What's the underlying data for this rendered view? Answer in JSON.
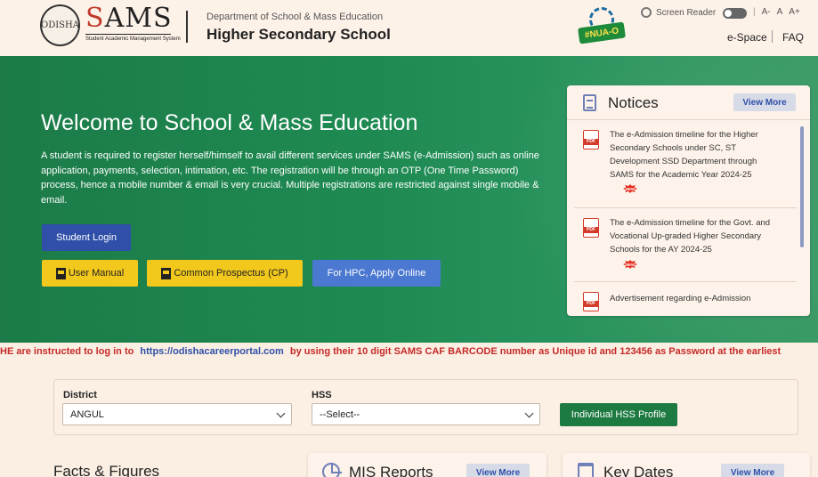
{
  "header": {
    "emblem_text": "ODISHA",
    "logo_s": "S",
    "logo_rest": "AMS",
    "logo_sub": "Student Academic Management System",
    "dept": "Department of School & Mass Education",
    "school": "Higher Secondary School",
    "nuao_label": "#NUA-O",
    "screen_reader": "Screen Reader",
    "font_decrease": "A-",
    "font_normal": "A",
    "font_increase": "A+",
    "espace": "e-Space",
    "faq": "FAQ"
  },
  "hero": {
    "title": "Welcome to School & Mass Education",
    "intro": "A student is required to register herself/himself to avail different services under SAMS (e-Admission) such as online application, payments, selection, intimation, etc. The registration will be through an OTP (One Time Password) process, hence a mobile number & email is very crucial. Multiple registrations are restricted against single mobile & email.",
    "login_label": "Student Login",
    "manual_label": "User Manual",
    "prospectus_label": "Common Prospectus (CP)",
    "hpc_label": "For HPC, Apply Online"
  },
  "notices": {
    "title": "Notices",
    "view_more": "View More",
    "items": [
      {
        "text": "The e-Admission timeline for the Higher Secondary Schools under SC, ST Development SSD Department through SAMS for the Academic Year 2024-25",
        "badge": "NEW"
      },
      {
        "text": "The e-Admission timeline for the Govt. and Vocational Up-graded Higher Secondary Schools for the AY 2024-25",
        "badge": "NEW"
      },
      {
        "text": "Advertisement regarding e-Admission",
        "badge": ""
      }
    ]
  },
  "marquee": {
    "before": "HE are instructed to log in to",
    "link": "https://odishacareerportal.com",
    "after": "by using their 10 digit SAMS CAF BARCODE number as Unique id and 123456 as Password at the earliest"
  },
  "filter": {
    "district_label": "District",
    "district_value": "ANGUL",
    "hss_label": "HSS",
    "hss_value": "--Select--",
    "hss_button": "Individual HSS Profile"
  },
  "bottom": {
    "facts_title": "Facts & Figures",
    "mis_title": "MIS Reports",
    "mis_view_more": "View More",
    "key_title": "Key Dates",
    "key_view_more": "View More"
  },
  "icons": [
    "emblem-icon",
    "screen-reader-icon",
    "document-icon",
    "pdf-icon",
    "chevron-down-icon",
    "chart-icon",
    "calendar-icon"
  ],
  "colors": {
    "hero_green": "#1e8a52",
    "primary_blue": "#2f4fa8",
    "yellow": "#f2c81d",
    "alert_red": "#c52a2a",
    "hss_green": "#1d7a41"
  }
}
